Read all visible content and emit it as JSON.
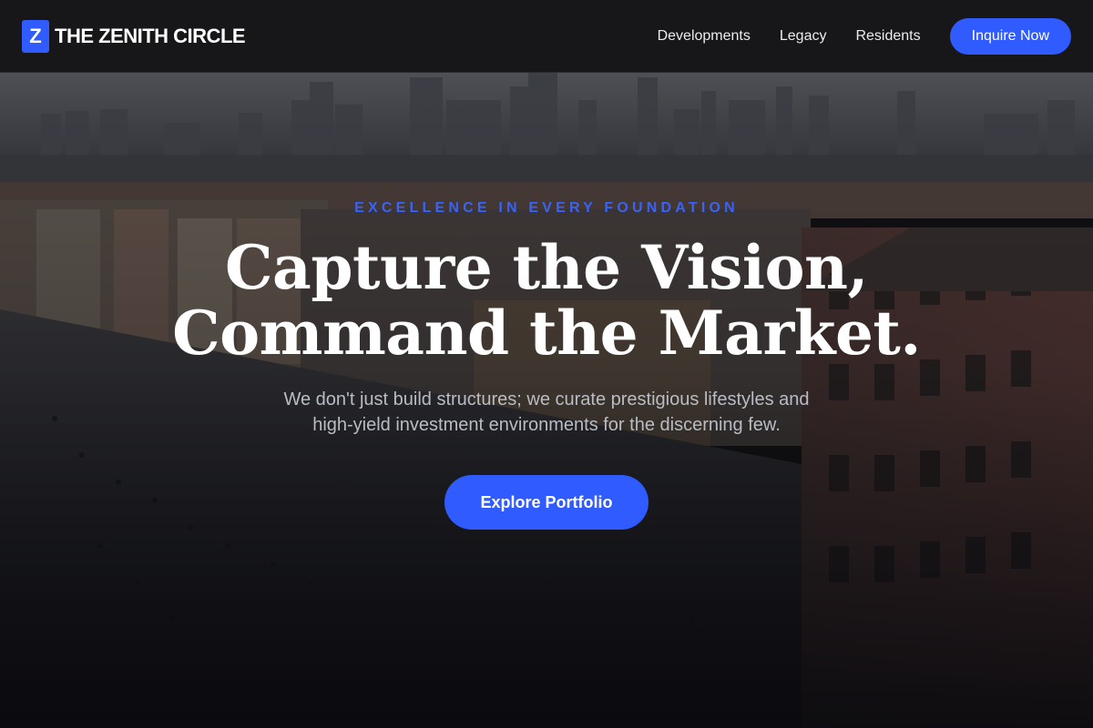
{
  "header": {
    "logo_mark": "Z",
    "brand_name": "THE ZENITH CIRCLE",
    "nav": [
      {
        "label": "Developments"
      },
      {
        "label": "Legacy"
      },
      {
        "label": "Residents"
      }
    ],
    "cta_label": "Inquire Now"
  },
  "hero": {
    "eyebrow": "EXCELLENCE IN EVERY FOUNDATION",
    "headline_line1": "Capture the Vision,",
    "headline_line2": "Command the Market.",
    "subcopy_line1": "We don't just build structures; we curate prestigious lifestyles and",
    "subcopy_line2": "high-yield investment environments for the discerning few.",
    "cta_label": "Explore Portfolio",
    "background_icon": "city-skyline-photo"
  },
  "colors": {
    "accent": "#2f5bff",
    "header_bg": "#17171a",
    "eyebrow": "#3a63f5",
    "subcopy": "#b9bcc4"
  }
}
